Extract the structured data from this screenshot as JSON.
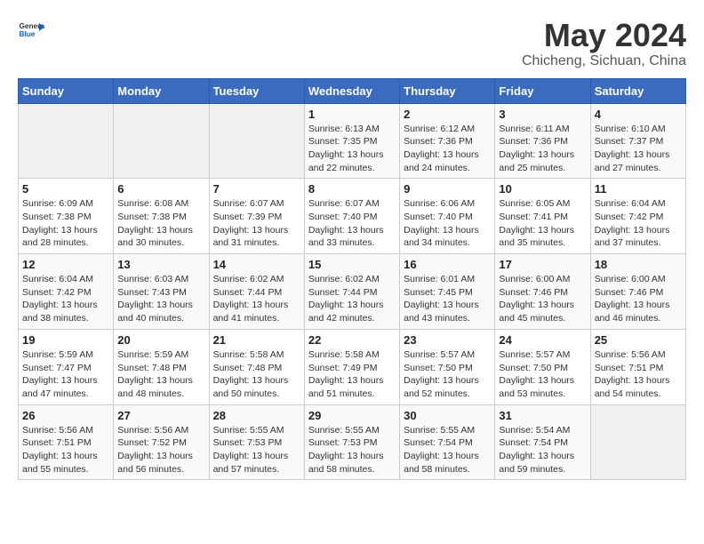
{
  "header": {
    "logo_general": "General",
    "logo_blue": "Blue",
    "month_year": "May 2024",
    "location": "Chicheng, Sichuan, China"
  },
  "weekdays": [
    "Sunday",
    "Monday",
    "Tuesday",
    "Wednesday",
    "Thursday",
    "Friday",
    "Saturday"
  ],
  "weeks": [
    [
      {
        "day": "",
        "info": ""
      },
      {
        "day": "",
        "info": ""
      },
      {
        "day": "",
        "info": ""
      },
      {
        "day": "1",
        "info": "Sunrise: 6:13 AM\nSunset: 7:35 PM\nDaylight: 13 hours and 22 minutes."
      },
      {
        "day": "2",
        "info": "Sunrise: 6:12 AM\nSunset: 7:36 PM\nDaylight: 13 hours and 24 minutes."
      },
      {
        "day": "3",
        "info": "Sunrise: 6:11 AM\nSunset: 7:36 PM\nDaylight: 13 hours and 25 minutes."
      },
      {
        "day": "4",
        "info": "Sunrise: 6:10 AM\nSunset: 7:37 PM\nDaylight: 13 hours and 27 minutes."
      }
    ],
    [
      {
        "day": "5",
        "info": "Sunrise: 6:09 AM\nSunset: 7:38 PM\nDaylight: 13 hours and 28 minutes."
      },
      {
        "day": "6",
        "info": "Sunrise: 6:08 AM\nSunset: 7:38 PM\nDaylight: 13 hours and 30 minutes."
      },
      {
        "day": "7",
        "info": "Sunrise: 6:07 AM\nSunset: 7:39 PM\nDaylight: 13 hours and 31 minutes."
      },
      {
        "day": "8",
        "info": "Sunrise: 6:07 AM\nSunset: 7:40 PM\nDaylight: 13 hours and 33 minutes."
      },
      {
        "day": "9",
        "info": "Sunrise: 6:06 AM\nSunset: 7:40 PM\nDaylight: 13 hours and 34 minutes."
      },
      {
        "day": "10",
        "info": "Sunrise: 6:05 AM\nSunset: 7:41 PM\nDaylight: 13 hours and 35 minutes."
      },
      {
        "day": "11",
        "info": "Sunrise: 6:04 AM\nSunset: 7:42 PM\nDaylight: 13 hours and 37 minutes."
      }
    ],
    [
      {
        "day": "12",
        "info": "Sunrise: 6:04 AM\nSunset: 7:42 PM\nDaylight: 13 hours and 38 minutes."
      },
      {
        "day": "13",
        "info": "Sunrise: 6:03 AM\nSunset: 7:43 PM\nDaylight: 13 hours and 40 minutes."
      },
      {
        "day": "14",
        "info": "Sunrise: 6:02 AM\nSunset: 7:44 PM\nDaylight: 13 hours and 41 minutes."
      },
      {
        "day": "15",
        "info": "Sunrise: 6:02 AM\nSunset: 7:44 PM\nDaylight: 13 hours and 42 minutes."
      },
      {
        "day": "16",
        "info": "Sunrise: 6:01 AM\nSunset: 7:45 PM\nDaylight: 13 hours and 43 minutes."
      },
      {
        "day": "17",
        "info": "Sunrise: 6:00 AM\nSunset: 7:46 PM\nDaylight: 13 hours and 45 minutes."
      },
      {
        "day": "18",
        "info": "Sunrise: 6:00 AM\nSunset: 7:46 PM\nDaylight: 13 hours and 46 minutes."
      }
    ],
    [
      {
        "day": "19",
        "info": "Sunrise: 5:59 AM\nSunset: 7:47 PM\nDaylight: 13 hours and 47 minutes."
      },
      {
        "day": "20",
        "info": "Sunrise: 5:59 AM\nSunset: 7:48 PM\nDaylight: 13 hours and 48 minutes."
      },
      {
        "day": "21",
        "info": "Sunrise: 5:58 AM\nSunset: 7:48 PM\nDaylight: 13 hours and 50 minutes."
      },
      {
        "day": "22",
        "info": "Sunrise: 5:58 AM\nSunset: 7:49 PM\nDaylight: 13 hours and 51 minutes."
      },
      {
        "day": "23",
        "info": "Sunrise: 5:57 AM\nSunset: 7:50 PM\nDaylight: 13 hours and 52 minutes."
      },
      {
        "day": "24",
        "info": "Sunrise: 5:57 AM\nSunset: 7:50 PM\nDaylight: 13 hours and 53 minutes."
      },
      {
        "day": "25",
        "info": "Sunrise: 5:56 AM\nSunset: 7:51 PM\nDaylight: 13 hours and 54 minutes."
      }
    ],
    [
      {
        "day": "26",
        "info": "Sunrise: 5:56 AM\nSunset: 7:51 PM\nDaylight: 13 hours and 55 minutes."
      },
      {
        "day": "27",
        "info": "Sunrise: 5:56 AM\nSunset: 7:52 PM\nDaylight: 13 hours and 56 minutes."
      },
      {
        "day": "28",
        "info": "Sunrise: 5:55 AM\nSunset: 7:53 PM\nDaylight: 13 hours and 57 minutes."
      },
      {
        "day": "29",
        "info": "Sunrise: 5:55 AM\nSunset: 7:53 PM\nDaylight: 13 hours and 58 minutes."
      },
      {
        "day": "30",
        "info": "Sunrise: 5:55 AM\nSunset: 7:54 PM\nDaylight: 13 hours and 58 minutes."
      },
      {
        "day": "31",
        "info": "Sunrise: 5:54 AM\nSunset: 7:54 PM\nDaylight: 13 hours and 59 minutes."
      },
      {
        "day": "",
        "info": ""
      }
    ]
  ]
}
